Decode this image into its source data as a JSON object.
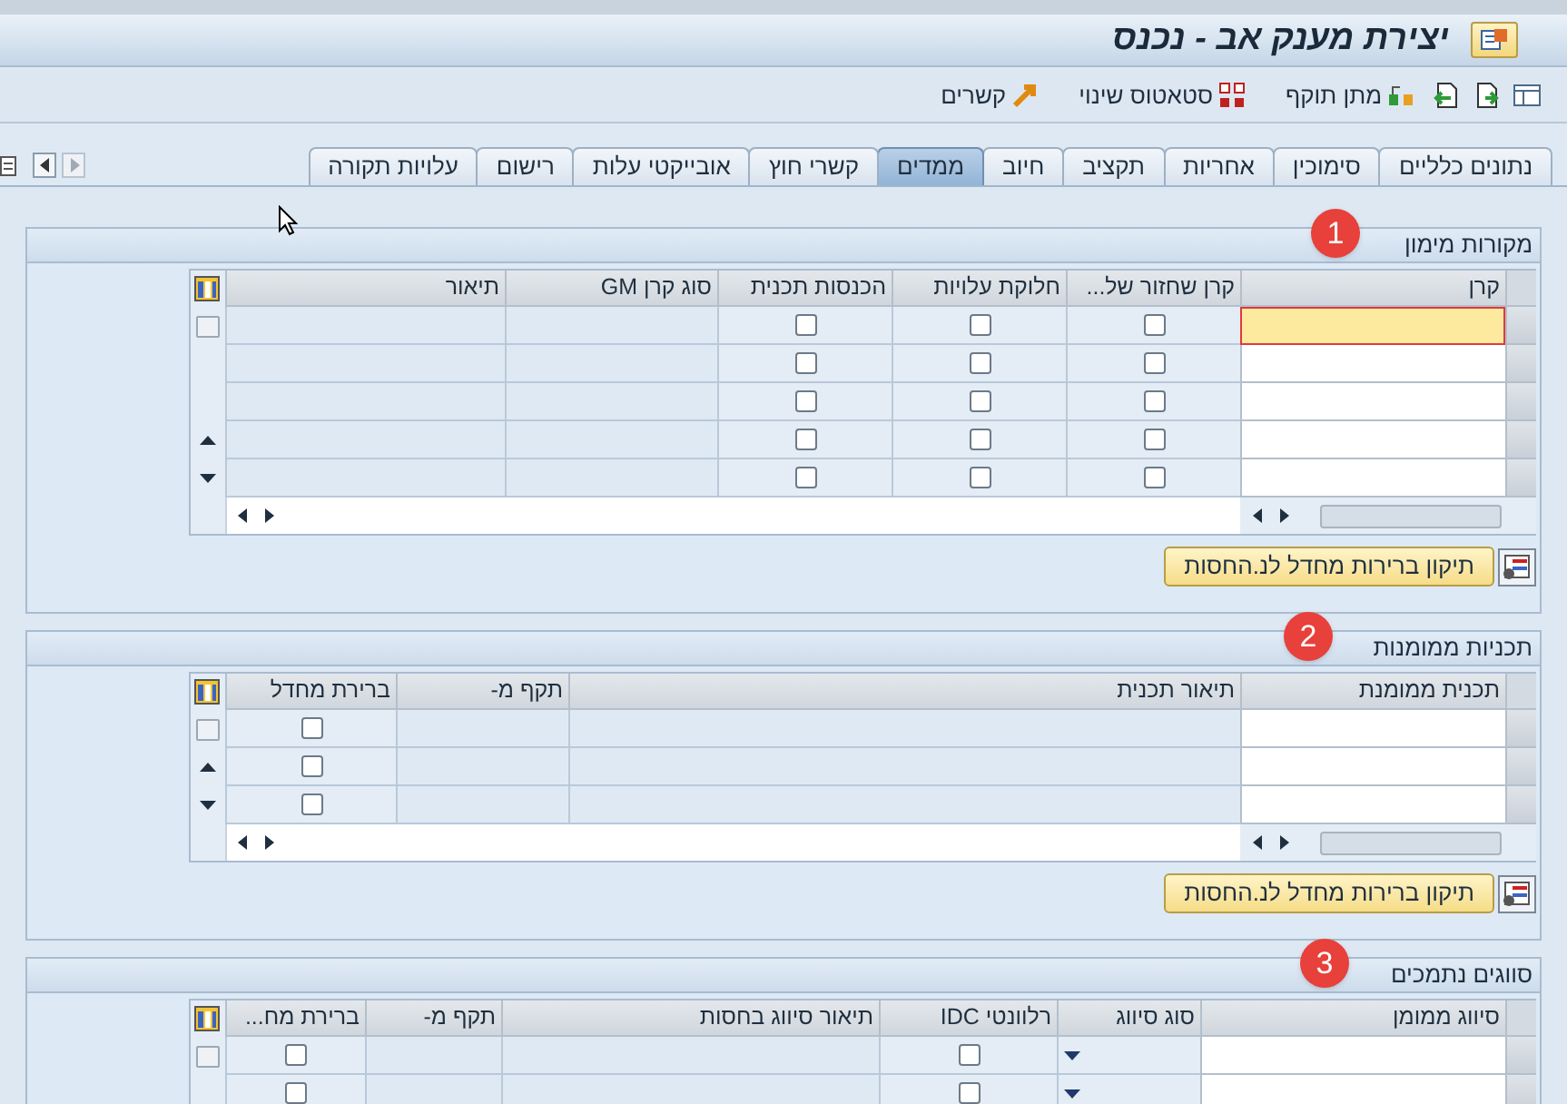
{
  "window": {
    "title": "יצירת מענק אב - נכנס"
  },
  "toolbar": {
    "buttons": [
      {
        "label": "מתן תוקף"
      },
      {
        "label": "סטאטוס שינוי"
      },
      {
        "label": "קשרים"
      }
    ]
  },
  "tabs": [
    {
      "label": "נתונים כלליים",
      "selected": false
    },
    {
      "label": "סימוכין",
      "selected": false
    },
    {
      "label": "אחריות",
      "selected": false
    },
    {
      "label": "תקציב",
      "selected": false
    },
    {
      "label": "חיוב",
      "selected": false
    },
    {
      "label": "ממדים",
      "selected": true
    },
    {
      "label": "קשרי חוץ",
      "selected": false
    },
    {
      "label": "אובייקטי עלות",
      "selected": false
    },
    {
      "label": "רישום",
      "selected": false
    },
    {
      "label": "עלויות תקורה",
      "selected": false
    }
  ],
  "sections": [
    {
      "title": "מקורות מימון",
      "badge": "1",
      "button": "תיקון ברירות מחדל לנ.החסות",
      "scroll_arrows": true,
      "horizontal_scrollbar": true,
      "columns": [
        "קרן",
        "קרן שחזור של...",
        "חלוקת עלויות",
        "הכנסות תכנית",
        "סוג קרן GM",
        "תיאור"
      ],
      "rows": [
        {
          "cells": [
            {
              "kind": "input",
              "focused": true
            },
            {
              "kind": "checkbox",
              "checked": false
            },
            {
              "kind": "checkbox",
              "checked": false
            },
            {
              "kind": "checkbox",
              "checked": false
            },
            {
              "kind": "text"
            },
            {
              "kind": "text"
            }
          ]
        },
        {
          "cells": [
            {
              "kind": "input",
              "focused": false
            },
            {
              "kind": "checkbox",
              "checked": false
            },
            {
              "kind": "checkbox",
              "checked": false
            },
            {
              "kind": "checkbox",
              "checked": false
            },
            {
              "kind": "text"
            },
            {
              "kind": "text"
            }
          ]
        },
        {
          "cells": [
            {
              "kind": "input",
              "focused": false
            },
            {
              "kind": "checkbox",
              "checked": false
            },
            {
              "kind": "checkbox",
              "checked": false
            },
            {
              "kind": "checkbox",
              "checked": false
            },
            {
              "kind": "text"
            },
            {
              "kind": "text"
            }
          ]
        },
        {
          "cells": [
            {
              "kind": "input",
              "focused": false
            },
            {
              "kind": "checkbox",
              "checked": false
            },
            {
              "kind": "checkbox",
              "checked": false
            },
            {
              "kind": "checkbox",
              "checked": false
            },
            {
              "kind": "text"
            },
            {
              "kind": "text"
            }
          ]
        },
        {
          "cells": [
            {
              "kind": "input",
              "focused": false
            },
            {
              "kind": "checkbox",
              "checked": false
            },
            {
              "kind": "checkbox",
              "checked": false
            },
            {
              "kind": "checkbox",
              "checked": false
            },
            {
              "kind": "text"
            },
            {
              "kind": "text"
            }
          ]
        }
      ]
    },
    {
      "title": "תכניות ממומנות",
      "badge": "2",
      "button": "תיקון ברירות מחדל לנ.החסות",
      "scroll_arrows": true,
      "horizontal_scrollbar": true,
      "columns": [
        "תכנית ממומנת",
        "תיאור תכנית",
        "תקף מ-",
        "ברירת מחדל"
      ],
      "rows": [
        {
          "cells": [
            {
              "kind": "input",
              "focused": false
            },
            {
              "kind": "text"
            },
            {
              "kind": "text"
            },
            {
              "kind": "checkbox",
              "checked": false
            }
          ]
        },
        {
          "cells": [
            {
              "kind": "input",
              "focused": false
            },
            {
              "kind": "text"
            },
            {
              "kind": "text"
            },
            {
              "kind": "checkbox",
              "checked": false
            }
          ]
        },
        {
          "cells": [
            {
              "kind": "input",
              "focused": false
            },
            {
              "kind": "text"
            },
            {
              "kind": "text"
            },
            {
              "kind": "checkbox",
              "checked": false
            }
          ]
        }
      ]
    },
    {
      "title": "סווגים נתמכים",
      "badge": "3",
      "scroll_arrows": false,
      "horizontal_scrollbar": false,
      "columns": [
        "סיווג ממומן",
        "סוג סיווג",
        "רלוונטי IDC",
        "תיאור סיווג בחסות",
        "תקף מ-",
        "ברירת מח..."
      ],
      "rows": [
        {
          "cells": [
            {
              "kind": "input",
              "focused": false
            },
            {
              "kind": "dropdown"
            },
            {
              "kind": "checkbox",
              "checked": false
            },
            {
              "kind": "text"
            },
            {
              "kind": "text"
            },
            {
              "kind": "checkbox",
              "checked": false
            }
          ]
        },
        {
          "cells": [
            {
              "kind": "input",
              "focused": false
            },
            {
              "kind": "dropdown"
            },
            {
              "kind": "checkbox",
              "checked": false
            },
            {
              "kind": "text"
            },
            {
              "kind": "text"
            },
            {
              "kind": "checkbox",
              "checked": false
            }
          ]
        }
      ]
    }
  ]
}
